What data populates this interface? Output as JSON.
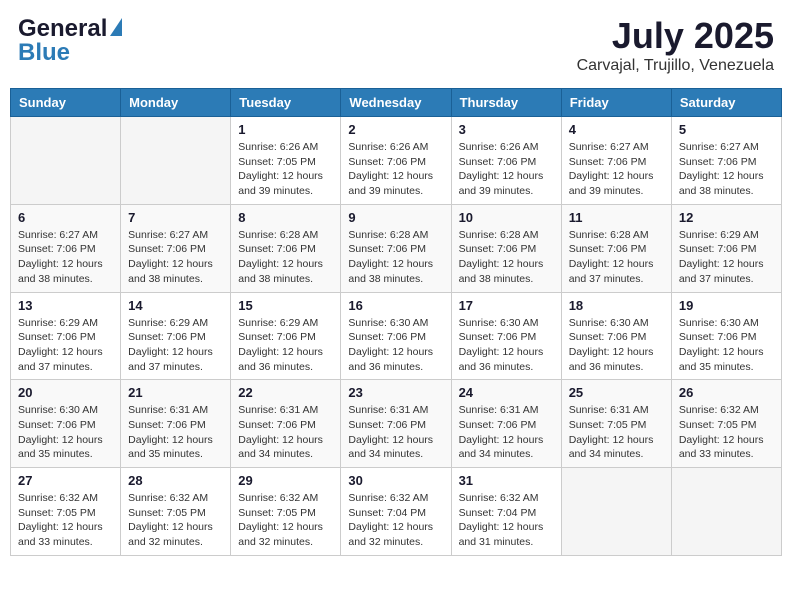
{
  "header": {
    "logo_line1": "General",
    "logo_line2": "Blue",
    "title": "July 2025",
    "subtitle": "Carvajal, Trujillo, Venezuela"
  },
  "weekdays": [
    "Sunday",
    "Monday",
    "Tuesday",
    "Wednesday",
    "Thursday",
    "Friday",
    "Saturday"
  ],
  "weeks": [
    [
      {
        "day": "",
        "info": ""
      },
      {
        "day": "",
        "info": ""
      },
      {
        "day": "1",
        "info": "Sunrise: 6:26 AM\nSunset: 7:05 PM\nDaylight: 12 hours and 39 minutes."
      },
      {
        "day": "2",
        "info": "Sunrise: 6:26 AM\nSunset: 7:06 PM\nDaylight: 12 hours and 39 minutes."
      },
      {
        "day": "3",
        "info": "Sunrise: 6:26 AM\nSunset: 7:06 PM\nDaylight: 12 hours and 39 minutes."
      },
      {
        "day": "4",
        "info": "Sunrise: 6:27 AM\nSunset: 7:06 PM\nDaylight: 12 hours and 39 minutes."
      },
      {
        "day": "5",
        "info": "Sunrise: 6:27 AM\nSunset: 7:06 PM\nDaylight: 12 hours and 38 minutes."
      }
    ],
    [
      {
        "day": "6",
        "info": "Sunrise: 6:27 AM\nSunset: 7:06 PM\nDaylight: 12 hours and 38 minutes."
      },
      {
        "day": "7",
        "info": "Sunrise: 6:27 AM\nSunset: 7:06 PM\nDaylight: 12 hours and 38 minutes."
      },
      {
        "day": "8",
        "info": "Sunrise: 6:28 AM\nSunset: 7:06 PM\nDaylight: 12 hours and 38 minutes."
      },
      {
        "day": "9",
        "info": "Sunrise: 6:28 AM\nSunset: 7:06 PM\nDaylight: 12 hours and 38 minutes."
      },
      {
        "day": "10",
        "info": "Sunrise: 6:28 AM\nSunset: 7:06 PM\nDaylight: 12 hours and 38 minutes."
      },
      {
        "day": "11",
        "info": "Sunrise: 6:28 AM\nSunset: 7:06 PM\nDaylight: 12 hours and 37 minutes."
      },
      {
        "day": "12",
        "info": "Sunrise: 6:29 AM\nSunset: 7:06 PM\nDaylight: 12 hours and 37 minutes."
      }
    ],
    [
      {
        "day": "13",
        "info": "Sunrise: 6:29 AM\nSunset: 7:06 PM\nDaylight: 12 hours and 37 minutes."
      },
      {
        "day": "14",
        "info": "Sunrise: 6:29 AM\nSunset: 7:06 PM\nDaylight: 12 hours and 37 minutes."
      },
      {
        "day": "15",
        "info": "Sunrise: 6:29 AM\nSunset: 7:06 PM\nDaylight: 12 hours and 36 minutes."
      },
      {
        "day": "16",
        "info": "Sunrise: 6:30 AM\nSunset: 7:06 PM\nDaylight: 12 hours and 36 minutes."
      },
      {
        "day": "17",
        "info": "Sunrise: 6:30 AM\nSunset: 7:06 PM\nDaylight: 12 hours and 36 minutes."
      },
      {
        "day": "18",
        "info": "Sunrise: 6:30 AM\nSunset: 7:06 PM\nDaylight: 12 hours and 36 minutes."
      },
      {
        "day": "19",
        "info": "Sunrise: 6:30 AM\nSunset: 7:06 PM\nDaylight: 12 hours and 35 minutes."
      }
    ],
    [
      {
        "day": "20",
        "info": "Sunrise: 6:30 AM\nSunset: 7:06 PM\nDaylight: 12 hours and 35 minutes."
      },
      {
        "day": "21",
        "info": "Sunrise: 6:31 AM\nSunset: 7:06 PM\nDaylight: 12 hours and 35 minutes."
      },
      {
        "day": "22",
        "info": "Sunrise: 6:31 AM\nSunset: 7:06 PM\nDaylight: 12 hours and 34 minutes."
      },
      {
        "day": "23",
        "info": "Sunrise: 6:31 AM\nSunset: 7:06 PM\nDaylight: 12 hours and 34 minutes."
      },
      {
        "day": "24",
        "info": "Sunrise: 6:31 AM\nSunset: 7:06 PM\nDaylight: 12 hours and 34 minutes."
      },
      {
        "day": "25",
        "info": "Sunrise: 6:31 AM\nSunset: 7:05 PM\nDaylight: 12 hours and 34 minutes."
      },
      {
        "day": "26",
        "info": "Sunrise: 6:32 AM\nSunset: 7:05 PM\nDaylight: 12 hours and 33 minutes."
      }
    ],
    [
      {
        "day": "27",
        "info": "Sunrise: 6:32 AM\nSunset: 7:05 PM\nDaylight: 12 hours and 33 minutes."
      },
      {
        "day": "28",
        "info": "Sunrise: 6:32 AM\nSunset: 7:05 PM\nDaylight: 12 hours and 32 minutes."
      },
      {
        "day": "29",
        "info": "Sunrise: 6:32 AM\nSunset: 7:05 PM\nDaylight: 12 hours and 32 minutes."
      },
      {
        "day": "30",
        "info": "Sunrise: 6:32 AM\nSunset: 7:04 PM\nDaylight: 12 hours and 32 minutes."
      },
      {
        "day": "31",
        "info": "Sunrise: 6:32 AM\nSunset: 7:04 PM\nDaylight: 12 hours and 31 minutes."
      },
      {
        "day": "",
        "info": ""
      },
      {
        "day": "",
        "info": ""
      }
    ]
  ]
}
